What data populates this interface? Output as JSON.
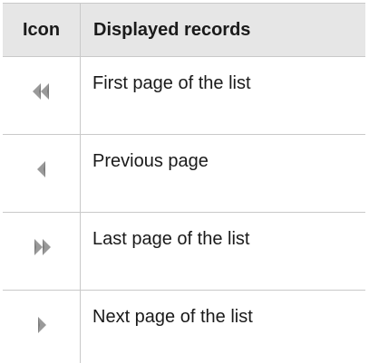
{
  "table": {
    "headers": {
      "icon": "Icon",
      "description": "Displayed records"
    },
    "rows": [
      {
        "icon": "double-left-arrow-icon",
        "description": "First page of the list"
      },
      {
        "icon": "left-arrow-icon",
        "description": "Previous page"
      },
      {
        "icon": "double-right-arrow-icon",
        "description": "Last page of the list"
      },
      {
        "icon": "right-arrow-icon",
        "description": "Next page of the list"
      }
    ]
  },
  "colors": {
    "header_bg": "#e6e6e6",
    "border": "#c9c9c9",
    "icon_fill": "#9a9a9a"
  }
}
